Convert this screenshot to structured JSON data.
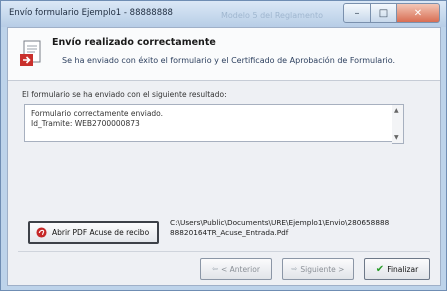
{
  "window": {
    "title": "Envío formulario Ejemplo1 - ",
    "title_masked": "88888888",
    "background_text": "Modelo 5 del Reglamento ",
    "controls": {
      "minimize": "–",
      "maximize": "□",
      "close": "✕"
    }
  },
  "header": {
    "title": "Envío realizado correctamente",
    "subtitle": "Se ha enviado con éxito el formulario y el Certificado de Aprobación de Formulario."
  },
  "result": {
    "label": "El formulario se ha enviado con el siguiente resultado:",
    "lines": [
      "Formulario correctamente enviado.",
      "Id_Tramite: WEB2700000873"
    ]
  },
  "pdf": {
    "button_label": "Abrir PDF Acuse de recibo",
    "path_line1": "C:\\Users\\Public\\Documents\\URE\\Ejemplo1\\Envio\\280658888",
    "path_line2": "88820164TR_Acuse_Entrada.Pdf"
  },
  "footer": {
    "prev_label": "< Anterior",
    "next_label": "Siguiente >",
    "finish_label": "Finalizar"
  }
}
